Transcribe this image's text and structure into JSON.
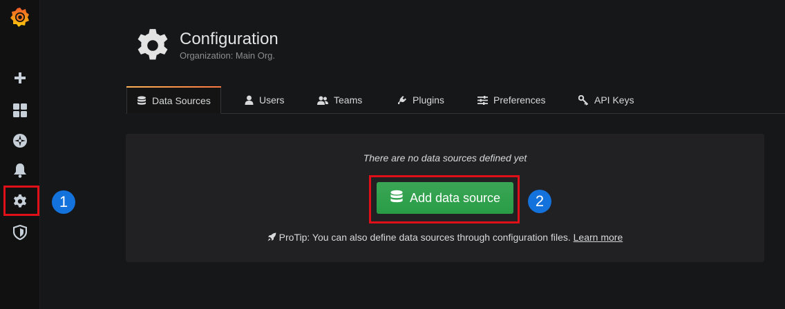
{
  "header": {
    "title": "Configuration",
    "subtitle": "Organization: Main Org."
  },
  "tabs": [
    {
      "label": "Data Sources",
      "icon": "database-icon",
      "active": true
    },
    {
      "label": "Users",
      "icon": "user-icon"
    },
    {
      "label": "Teams",
      "icon": "users-icon"
    },
    {
      "label": "Plugins",
      "icon": "plug-icon"
    },
    {
      "label": "Preferences",
      "icon": "sliders-icon"
    },
    {
      "label": "API Keys",
      "icon": "key-icon"
    }
  ],
  "panel": {
    "empty_text": "There are no data sources defined yet",
    "add_button": "Add data source",
    "protip": "ProTip: You can also define data sources through configuration files.",
    "learn_more": "Learn more"
  },
  "sidebar": {
    "items": [
      "create-icon",
      "dashboards-icon",
      "explore-icon",
      "alerting-icon",
      "configuration-icon",
      "server-admin-icon"
    ]
  },
  "annotations": {
    "badge1": "1",
    "badge2": "2",
    "highlight_color": "#e00f18",
    "badge_color": "#1472dc"
  },
  "colors": {
    "accent_green": "#299c46",
    "tab_accent": "#ff7941"
  }
}
